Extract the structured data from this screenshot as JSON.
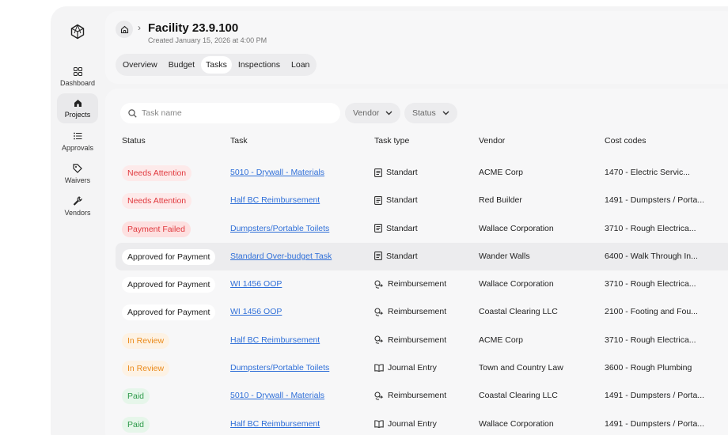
{
  "sidebar": {
    "items": [
      {
        "label": "Dashboard",
        "icon": "grid-icon"
      },
      {
        "label": "Projects",
        "icon": "home-icon",
        "active": true
      },
      {
        "label": "Approvals",
        "icon": "list-icon"
      },
      {
        "label": "Waivers",
        "icon": "tag-icon"
      },
      {
        "label": "Vendors",
        "icon": "wrench-icon"
      }
    ]
  },
  "header": {
    "title": "Facility 23.9.100",
    "subtitle": "Created January 15, 2026 at 4:00 PM",
    "tabs": [
      {
        "label": "Overview"
      },
      {
        "label": "Budget"
      },
      {
        "label": "Tasks",
        "active": true
      },
      {
        "label": "Inspections"
      },
      {
        "label": "Loan"
      }
    ]
  },
  "toolbar": {
    "search_placeholder": "Task name",
    "vendor_filter": "Vendor",
    "status_filter": "Status"
  },
  "table": {
    "columns": [
      "Status",
      "Task",
      "Task type",
      "Vendor",
      "Cost codes"
    ],
    "rows": [
      {
        "status": "Needs Attention",
        "status_kind": "attention",
        "task": "5010 - Drywall - Materials",
        "type": "Standart",
        "type_icon": "document-icon",
        "vendor": "ACME Corp",
        "cost": "1470 - Electric Servic..."
      },
      {
        "status": "Needs Attention",
        "status_kind": "attention",
        "task": "Half BC Reimbursement",
        "type": "Standart",
        "type_icon": "document-icon",
        "vendor": "Red Builder",
        "cost": "1491 - Dumpsters / Porta..."
      },
      {
        "status": "Payment Failed",
        "status_kind": "failed",
        "task": "Dumpsters/Portable Toilets",
        "type": "Standart",
        "type_icon": "document-icon",
        "vendor": "Wallace Corporation",
        "cost": "3710 - Rough Electrica..."
      },
      {
        "status": "Approved for Payment",
        "status_kind": "approved",
        "task": "Standard Over-budget Task",
        "type": "Standart",
        "type_icon": "document-icon",
        "vendor": "Wander Walls",
        "cost": "6400 - Walk Through In...",
        "highlight": true
      },
      {
        "status": "Approved for Payment",
        "status_kind": "approved",
        "task": "WI 1456 OOP",
        "type": "Reimbursement",
        "type_icon": "money-return-icon",
        "vendor": "Wallace Corporation",
        "cost": "3710 - Rough Electrica..."
      },
      {
        "status": "Approved for Payment",
        "status_kind": "approved",
        "task": "WI 1456 OOP",
        "type": "Reimbursement",
        "type_icon": "money-return-icon",
        "vendor": "Coastal Clearing  LLC",
        "cost": "2100 - Footing and Fou..."
      },
      {
        "status": "In Review",
        "status_kind": "review",
        "task": "Half BC Reimbursement",
        "type": "Reimbursement",
        "type_icon": "money-return-icon",
        "vendor": "ACME Corp",
        "cost": "3710 - Rough Electrica..."
      },
      {
        "status": "In Review",
        "status_kind": "review",
        "task": "Dumpsters/Portable Toilets",
        "type": "Journal Entry",
        "type_icon": "book-icon",
        "vendor": "Town and Country Law",
        "cost": "3600 - Rough Plumbing"
      },
      {
        "status": "Paid",
        "status_kind": "paid",
        "task": "5010 - Drywall - Materials",
        "type": "Reimbursement",
        "type_icon": "money-return-icon",
        "vendor": "Coastal Clearing  LLC",
        "cost": "1491 - Dumpsters / Porta..."
      },
      {
        "status": "Paid",
        "status_kind": "paid",
        "task": "Half BC Reimbursement",
        "type": "Journal Entry",
        "type_icon": "book-icon",
        "vendor": "Wallace Corporation",
        "cost": "1491 - Dumpsters / Porta..."
      }
    ]
  },
  "colors": {
    "link": "#2f6fd8",
    "attention": "#e0393e",
    "review": "#ea8a1a",
    "paid": "#2e9a4a"
  }
}
